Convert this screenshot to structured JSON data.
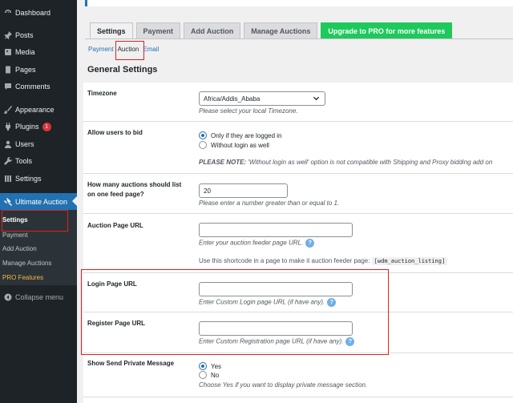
{
  "sidebar": {
    "items": [
      {
        "label": "Dashboard",
        "icon": "dashboard-icon"
      },
      {
        "label": "Posts",
        "icon": "pin-icon"
      },
      {
        "label": "Media",
        "icon": "media-icon"
      },
      {
        "label": "Pages",
        "icon": "pages-icon"
      },
      {
        "label": "Comments",
        "icon": "comments-icon"
      },
      {
        "label": "Appearance",
        "icon": "appearance-icon"
      },
      {
        "label": "Plugins",
        "icon": "plugins-icon",
        "badge": "1"
      },
      {
        "label": "Users",
        "icon": "users-icon"
      },
      {
        "label": "Tools",
        "icon": "tools-icon"
      },
      {
        "label": "Settings",
        "icon": "settings-icon"
      },
      {
        "label": "Ultimate Auction",
        "icon": "auction-icon"
      }
    ],
    "submenu": [
      "Settings",
      "Payment",
      "Add Auction",
      "Manage Auctions",
      "PRO Features"
    ],
    "collapse": "Collapse menu"
  },
  "tabs": [
    "Settings",
    "Payment",
    "Add Auction",
    "Manage Auctions",
    "Upgrade to PRO for more features"
  ],
  "subtabs": [
    "Payment",
    "Auction",
    "Email"
  ],
  "section_title": "General Settings",
  "fields": {
    "timezone": {
      "label": "Timezone",
      "value": "Africa/Addis_Ababa",
      "desc": "Please select your local Timezone."
    },
    "allow_bid": {
      "label": "Allow users to bid",
      "opt1": "Only if they are logged in",
      "opt2": "Without login as well",
      "note_bold": "PLEASE NOTE:",
      "note": " 'Without login as well' option is not compatible with Shipping and Proxy bidding add on"
    },
    "feed_count": {
      "label1": "How many auctions should list",
      "label2": "on one feed page?",
      "value": "20",
      "desc": "Please enter a number greater than or equal to 1."
    },
    "auction_url": {
      "label": "Auction Page URL",
      "desc": "Enter your auction feeder page URL.",
      "shortcode_text": "Use this shortcode in a page to make it auction feeder page:",
      "shortcode": "[wdm_auction_listing]"
    },
    "login_url": {
      "label": "Login Page URL",
      "desc": "Enter Custom Login page URL (if have any)."
    },
    "register_url": {
      "label": "Register Page URL",
      "desc": "Enter Custom Registration page URL (if have any)."
    },
    "private_msg": {
      "label": "Show Send Private Message",
      "opt1": "Yes",
      "opt2": "No",
      "desc": "Choose Yes if you want to display private message section."
    }
  },
  "help_glyph": "?"
}
